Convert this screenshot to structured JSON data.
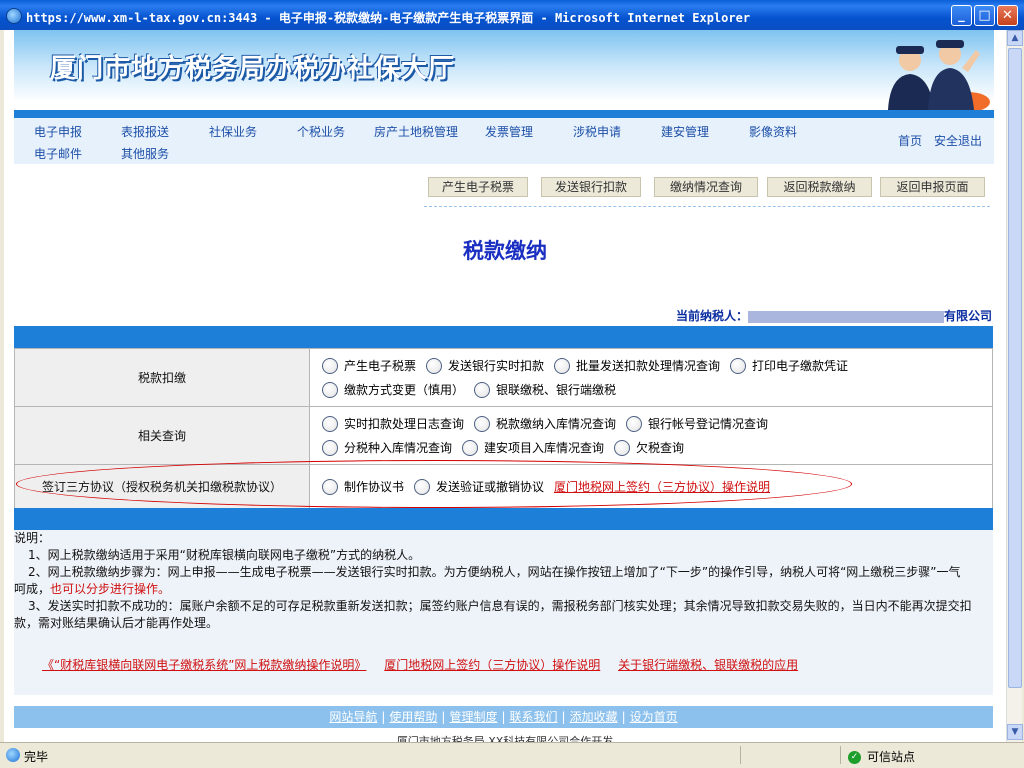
{
  "window": {
    "title": "https://www.xm-l-tax.gov.cn:3443 - 电子申报-税款缴纳-电子缴款产生电子税票界面 - Microsoft Internet Explorer",
    "min_glyph": "_",
    "max_glyph": "□",
    "close_glyph": "✕"
  },
  "header": {
    "site_title": "厦门市地方税务局办税办社保大厅"
  },
  "nav": {
    "row1": [
      "电子申报",
      "表报报送",
      "社保业务",
      "个税业务",
      "房产土地税管理",
      "发票管理",
      "涉税申请",
      "建安管理",
      "影像资料"
    ],
    "row2": [
      "电子邮件",
      "其他服务"
    ],
    "home": "首页",
    "logout": "安全退出"
  },
  "actions": [
    "产生电子税票",
    "发送银行扣款",
    "缴纳情况查询",
    "返回税款缴纳",
    "返回申报页面"
  ],
  "page": {
    "title": "税款缴纳",
    "taxpayer_label": "当前纳税人：",
    "taxpayer_suffix": "有限公司"
  },
  "sections": {
    "payment": {
      "label": "税款扣缴",
      "row1": [
        "产生电子税票",
        "发送银行实时扣款",
        "批量发送扣款处理情况查询",
        "打印电子缴款凭证"
      ],
      "row2": [
        "缴款方式变更（慎用）",
        "银联缴税、银行端缴税"
      ]
    },
    "query": {
      "label": "相关查询",
      "row1": [
        "实时扣款处理日志查询",
        "税款缴纳入库情况查询",
        "银行帐号登记情况查询"
      ],
      "row2": [
        "分税种入库情况查询",
        "建安项目入库情况查询",
        "欠税查询"
      ]
    },
    "agreement": {
      "label": "签订三方协议（授权税务机关扣缴税款协议）",
      "options": [
        "制作协议书",
        "发送验证或撤销协议"
      ],
      "link": "厦门地税网上签约（三方协议）操作说明"
    }
  },
  "notes": {
    "heading": "说明：",
    "n1": "1、网上税款缴纳适用于采用“财税库银横向联网电子缴税”方式的纳税人。",
    "n2a": "2、网上税款缴纳步骤为：网上申报——生成电子税票——发送银行实时扣款。为方便纳税人，网站在操作按钮上增加了“下一步”的操作引导，纳税人可将“网上缴税三步骤”一气",
    "n2b": "呵成，",
    "n2c": "也可以分步进行操作。",
    "n3a": "3、发送实时扣款不成功的：属账户余额不足的可存足税款重新发送扣款；属签约账户信息有误的，需报税务部门核实处理；其余情况导致扣款交易失败的，当日内不能再次提交扣",
    "n3b": "款，需对账结果确认后才能再作处理。",
    "links": [
      "《“财税库银横向联网电子缴税系统”网上税款缴纳操作说明》",
      "厦门地税网上签约（三方协议）操作说明",
      "关于银行端缴税、银联缴税的应用"
    ]
  },
  "footer": {
    "links": [
      "网站导航",
      "使用帮助",
      "管理制度",
      "联系我们",
      "添加收藏",
      "设为首页"
    ],
    "copyright": "厦门市地方税务局  XX科技有限公司合作开发"
  },
  "status": {
    "left": "完毕",
    "zone": "可信站点"
  },
  "colors": {
    "accent_blue": "#1e7fd8",
    "link_red": "#d01010",
    "title_blue": "#1a2fc2"
  }
}
